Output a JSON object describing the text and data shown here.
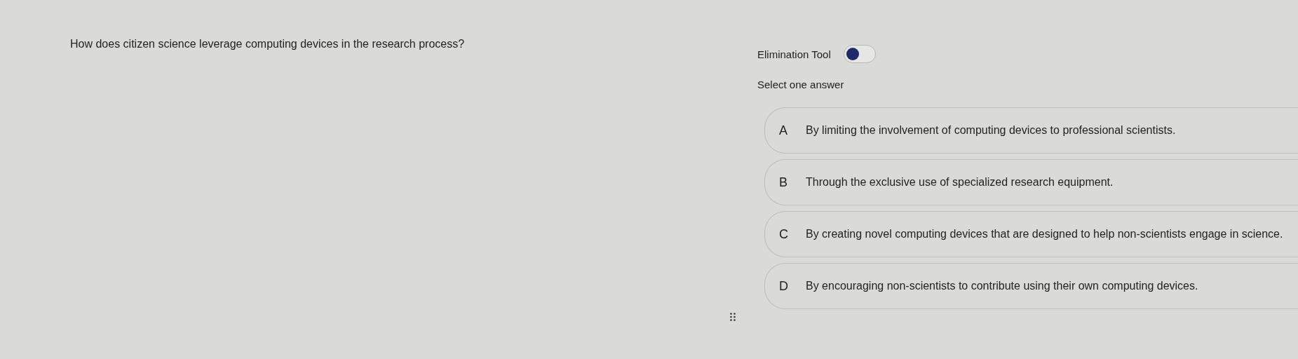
{
  "question": "How does citizen science leverage computing devices in the research process?",
  "elimination_tool": {
    "label": "Elimination Tool",
    "on": false
  },
  "instruction": "Select one answer",
  "options": [
    {
      "letter": "A",
      "text": "By limiting the involvement of computing devices to professional scientists.",
      "selected": false
    },
    {
      "letter": "B",
      "text": "Through the exclusive use of specialized research equipment.",
      "selected": false
    },
    {
      "letter": "C",
      "text": "By creating novel computing devices that are designed to help non-scientists engage in science.",
      "selected": false
    },
    {
      "letter": "D",
      "text": "By encouraging non-scientists to contribute using their own computing devices.",
      "selected": false
    }
  ]
}
